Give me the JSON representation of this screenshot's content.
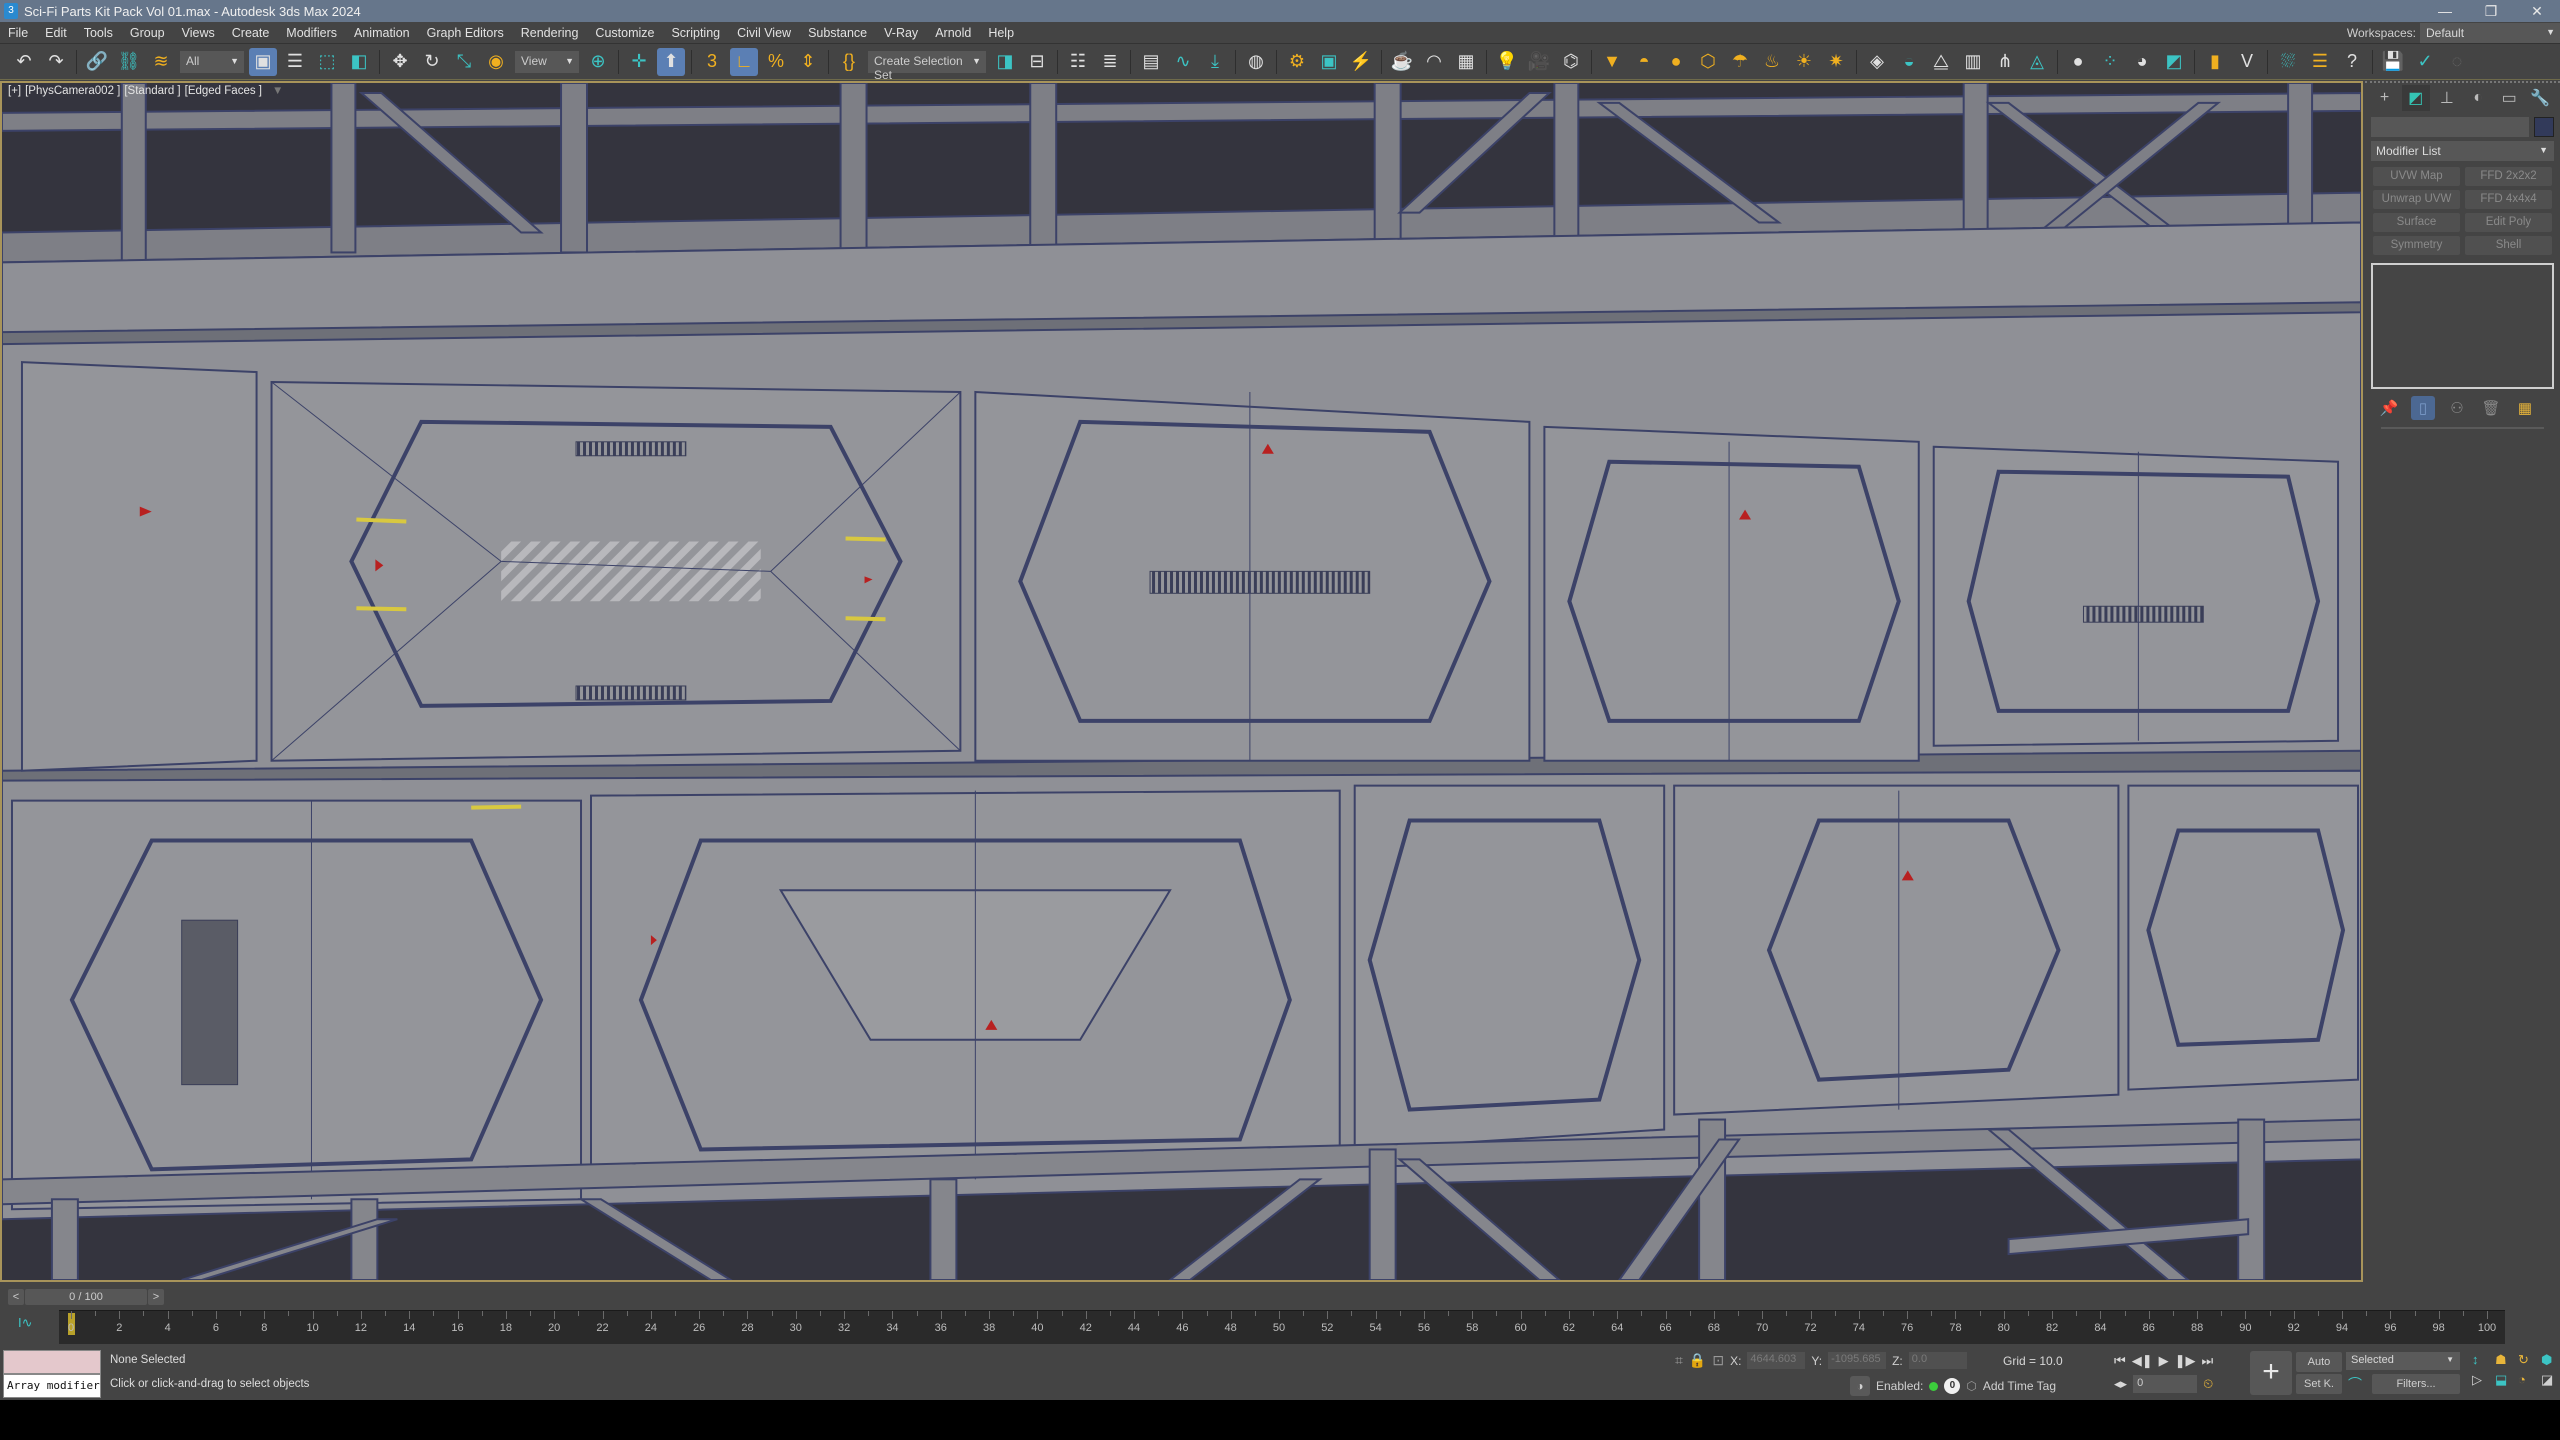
{
  "window": {
    "title": "Sci-Fi Parts Kit Pack Vol 01.max - Autodesk 3ds Max 2024",
    "app_icon": "3",
    "controls": [
      "minimize-icon",
      "restore-icon",
      "close-icon"
    ],
    "minimize": "—",
    "restore": "❐",
    "close": "✕"
  },
  "menu": {
    "items": [
      "File",
      "Edit",
      "Tools",
      "Group",
      "Views",
      "Create",
      "Modifiers",
      "Animation",
      "Graph Editors",
      "Rendering",
      "Customize",
      "Scripting",
      "Civil View",
      "Substance",
      "V-Ray",
      "Arnold",
      "Help"
    ],
    "workspaces_label": "Workspaces:",
    "workspaces_value": "Default"
  },
  "toolbar": {
    "selection_filter": "All",
    "ref_coord_system": "View",
    "named_selection_set": "Create Selection Set",
    "icons": {
      "undo": "↶",
      "redo": "↷",
      "link": "🔗",
      "unlink": "⛓",
      "bind_space_warp": "≋",
      "select_object": "▣",
      "select_by_name": "☰",
      "rect_region": "⬚",
      "window_crossing": "◧",
      "move": "✥",
      "rotate": "↻",
      "scale": "⤡",
      "placement": "◉",
      "pivot": "⊕",
      "manipulate": "✛",
      "keyboard_shortcut": "⬆",
      "snap_3d": "3",
      "angle_snap": "∟",
      "percent_snap": "%",
      "spinner_snap": "⇕",
      "edit_named_sel": "{}",
      "mirror": "◨",
      "align": "⊟",
      "scene_explorer": "☷",
      "layer_explorer": "≣",
      "toggle_ribbon": "▤",
      "curve_editor": "∿",
      "dope_sheet": "⤓",
      "material_editor": "◍",
      "render_setup": "⚙",
      "rendered_frame": "▣",
      "render": "⚡",
      "render_iterative": "☕",
      "environment": "◠",
      "render_online": "▦",
      "vray_light": "💡",
      "vray_cam": "🎥",
      "vray_physcam": "⌬",
      "vray_plane_light": "▼",
      "vray_dome": "◓",
      "vray_sphere": "●",
      "vray_mesh_light": "⬡",
      "vray_ies": "☂",
      "vray_ambient": "♨",
      "vray_sun": "☀",
      "vray_sky": "✷",
      "vray_proxy": "◈",
      "vray_fur_ball": "◒",
      "vray_plane": "⧋",
      "vray_instancer": "▥",
      "vray_fur": "⋔",
      "vray_volume": "◬",
      "vray_mtl": "●",
      "vray_mtl_lib": "⁘",
      "vray_lighting": "◕",
      "vray_vfb": "◩",
      "vray_scene_converter": "▮",
      "vray_logo": "V",
      "forest": "⛆",
      "notes": "☰",
      "help": "?",
      "autosave": "💾",
      "sync": "✓",
      "spinner": "◌"
    }
  },
  "viewport": {
    "label_plus": "[+]",
    "label_camera": "[PhysCamera002 ]",
    "label_shading": "[Standard ]",
    "label_mode": "[Edged Faces ]",
    "filter_icon": "▼",
    "background_color": "#34343e",
    "panel_color": "#8e8f94",
    "wire_color": "#3c4268",
    "accent_yellow": "#d8c840",
    "accent_red": "#b82020"
  },
  "command_panel": {
    "tabs": [
      {
        "name": "create",
        "glyph": "+"
      },
      {
        "name": "modify",
        "glyph": "◩"
      },
      {
        "name": "hierarchy",
        "glyph": "⊥"
      },
      {
        "name": "motion",
        "glyph": "◐"
      },
      {
        "name": "display",
        "glyph": "▭"
      },
      {
        "name": "utilities",
        "glyph": "🔧"
      }
    ],
    "object_name": "",
    "object_color": "#323a5a",
    "modifier_list_label": "Modifier List",
    "modifier_buttons": [
      "UVW Map",
      "FFD 2x2x2",
      "Unwrap UVW",
      "FFD 4x4x4",
      "Surface",
      "Edit Poly",
      "Symmetry",
      "Shell"
    ],
    "stack_tools": [
      "pin-stack",
      "show-end-result",
      "make-unique",
      "remove-modifier",
      "configure-modifier-sets"
    ],
    "stack_glyphs": [
      "📌",
      "▯",
      "⚇",
      "🗑",
      "▦"
    ]
  },
  "time_slider": {
    "prev": "<",
    "frame_display": "0 / 100",
    "next": ">",
    "current_frame": 0,
    "start": 0,
    "end": 100,
    "ticks": [
      0,
      2,
      4,
      6,
      8,
      10,
      12,
      14,
      16,
      18,
      20,
      22,
      24,
      26,
      28,
      30,
      32,
      34,
      36,
      38,
      40,
      42,
      44,
      46,
      48,
      50,
      52,
      54,
      56,
      58,
      60,
      62,
      64,
      66,
      68,
      70,
      72,
      74,
      76,
      78,
      80,
      82,
      84,
      86,
      88,
      90,
      92,
      94,
      96,
      98,
      100
    ],
    "curve_icon": "I∿"
  },
  "status": {
    "maxscript_listener_line": "Array modifier",
    "selection": "None Selected",
    "prompt": "Click or click-and-drag to select objects",
    "x_label": "X:",
    "x_value": "4644.603",
    "y_label": "Y:",
    "y_value": "-1095.685",
    "z_label": "Z:",
    "z_value": "0.0",
    "grid": "Grid = 10.0",
    "adaptive_degradation": "Enabled:",
    "adaptive_count": "0",
    "add_time_tag": "Add Time Tag",
    "isolate_icon": "⌗",
    "lock_icon": "🔒",
    "abs_mode_icon": "⊡",
    "shield_icon": "◑",
    "cube_icon": "⬡"
  },
  "animation": {
    "go_to_start": "⏮",
    "prev_frame": "◀❚",
    "play": "▶",
    "next_frame": "❚▶",
    "go_to_end": "⏭",
    "key_mode": "◂▸",
    "frame_value": "0",
    "time_config": "⏲",
    "set_key_big": "+",
    "auto_key": "Auto",
    "set_key": "Set K.",
    "key_filter_selection": "Selected",
    "key_tangent": "⌒",
    "filters": "Filters...",
    "nav_icons": [
      "↕",
      "☗",
      "↻",
      "⬢",
      "▷",
      "⬓",
      "◔",
      "◪"
    ]
  }
}
